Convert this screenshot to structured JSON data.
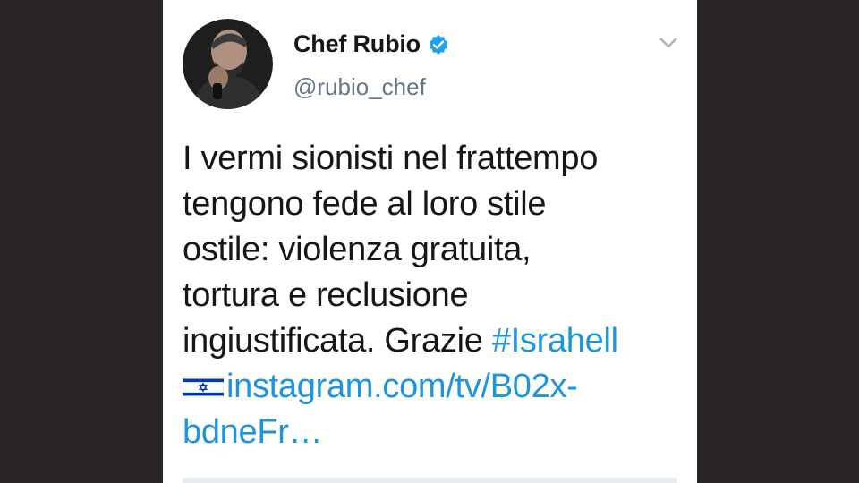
{
  "tweet": {
    "author": {
      "name": "Chef Rubio",
      "handle": "@rubio_chef",
      "verified": true
    },
    "text_lines": [
      "I vermi sionisti nel frattempo",
      "tengono fede al loro stile",
      "ostile: violenza gratuita,",
      "tortura e reclusione",
      "ingiustificata. Grazie "
    ],
    "hashtag": "#Israhell",
    "link_line1": "instagram.com/tv/B02x-",
    "link_line2": "bdneFr…",
    "flag_emoji": "flag-israel"
  },
  "colors": {
    "background": "#2a2525",
    "card": "#ffffff",
    "text": "#14171a",
    "secondary": "#657786",
    "link": "#1b95e0",
    "verified": "#1da1f2"
  }
}
